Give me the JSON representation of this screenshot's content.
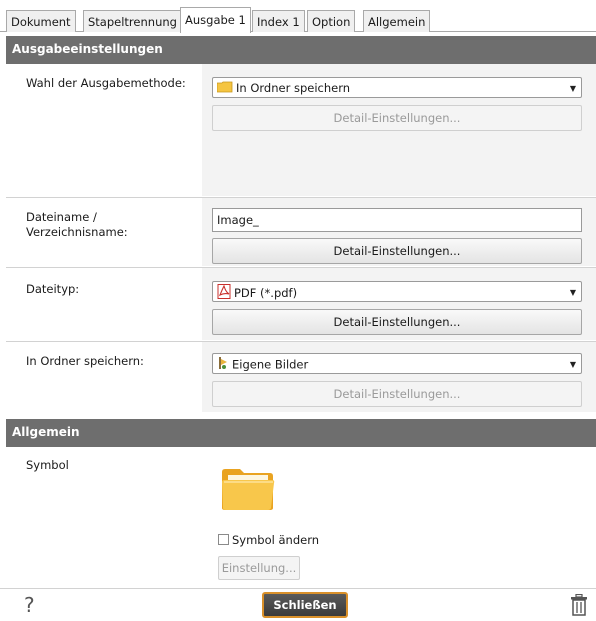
{
  "tabs": [
    {
      "label": "Dokument",
      "active": false
    },
    {
      "label": "Stapeltrennung",
      "active": false
    },
    {
      "label": "Ausgabe 1",
      "active": true
    },
    {
      "label": "Index 1",
      "active": false
    },
    {
      "label": "Option",
      "active": false
    },
    {
      "label": "Allgemein",
      "active": false
    }
  ],
  "output_section": {
    "title": "Ausgabeeinstellungen",
    "method_label": "Wahl der Ausgabemethode:",
    "method_value": "In Ordner speichern",
    "method_detail": "Detail-Einstellungen...",
    "filename_label_1": "Dateiname /",
    "filename_label_2": "Verzeichnisname:",
    "filename_value": "Image_",
    "filename_detail": "Detail-Einstellungen...",
    "filetype_label": "Dateityp:",
    "filetype_value": "PDF (*.pdf)",
    "filetype_detail": "Detail-Einstellungen...",
    "folder_label": "In Ordner speichern:",
    "folder_value": "Eigene Bilder",
    "folder_detail": "Detail-Einstellungen..."
  },
  "general_section": {
    "title": "Allgemein",
    "symbol_label": "Symbol",
    "change_symbol_label": "Symbol ändern",
    "change_symbol_checked": false,
    "settings_button": "Einstellung..."
  },
  "footer": {
    "help_label": "?",
    "close_label": "Schließen"
  },
  "icons": {
    "folder": "folder-icon",
    "pdf": "pdf-icon",
    "pictures": "pictures-folder-icon",
    "trash": "trash-icon",
    "help": "help-icon"
  },
  "colors": {
    "section_header": "#6e6e6e",
    "close_border": "#d9902a",
    "right_panel": "#f3f3f3"
  }
}
